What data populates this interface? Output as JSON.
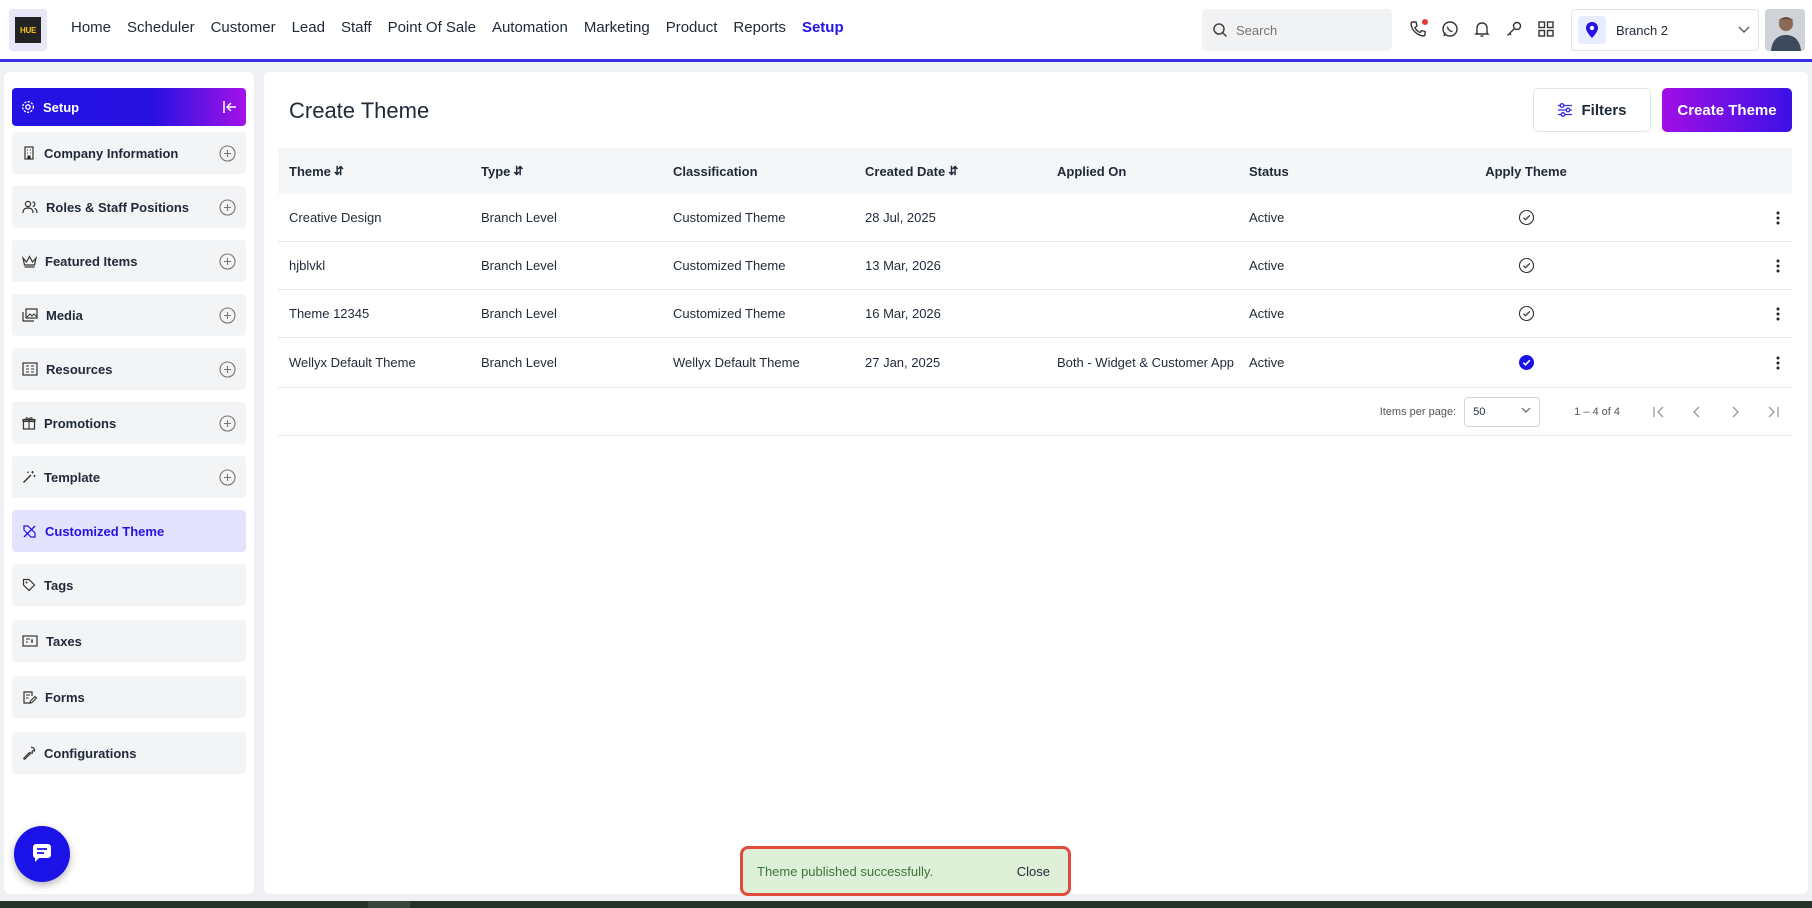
{
  "topnav": {
    "logo_text": "HUE",
    "items": [
      {
        "label": "Home"
      },
      {
        "label": "Scheduler"
      },
      {
        "label": "Customer"
      },
      {
        "label": "Lead"
      },
      {
        "label": "Staff"
      },
      {
        "label": "Point Of Sale"
      },
      {
        "label": "Automation"
      },
      {
        "label": "Marketing"
      },
      {
        "label": "Product"
      },
      {
        "label": "Reports"
      },
      {
        "label": "Setup"
      }
    ],
    "active_item": "Setup",
    "search": {
      "placeholder": "Search"
    },
    "branch": {
      "label": "Branch 2"
    },
    "accent_color": "#2412e6"
  },
  "sidebar": {
    "header": {
      "label": "Setup"
    },
    "items": [
      {
        "label": "Company Information",
        "icon": "building-icon",
        "expandable": true
      },
      {
        "label": "Roles & Staff Positions",
        "icon": "users-icon",
        "expandable": true
      },
      {
        "label": "Featured Items",
        "icon": "crown-icon",
        "expandable": true
      },
      {
        "label": "Media",
        "icon": "images-icon",
        "expandable": true
      },
      {
        "label": "Resources",
        "icon": "resources-icon",
        "expandable": true
      },
      {
        "label": "Promotions",
        "icon": "gift-icon",
        "expandable": true
      },
      {
        "label": "Template",
        "icon": "magic-wand-icon",
        "expandable": true
      },
      {
        "label": "Customized Theme",
        "icon": "ruler-pencil-icon",
        "expandable": false,
        "active": true
      },
      {
        "label": "Tags",
        "icon": "tag-icon",
        "expandable": false
      },
      {
        "label": "Taxes",
        "icon": "tax-icon",
        "expandable": false
      },
      {
        "label": "Forms",
        "icon": "form-icon",
        "expandable": false
      },
      {
        "label": "Configurations",
        "icon": "wrench-icon",
        "expandable": false
      }
    ]
  },
  "main": {
    "title": "Create Theme",
    "filters_label": "Filters",
    "create_label": "Create Theme",
    "columns": [
      "Theme",
      "Type",
      "Classification",
      "Created Date",
      "Applied On",
      "Status",
      "Apply Theme"
    ],
    "sortable_columns": [
      "Theme",
      "Type",
      "Created Date"
    ],
    "rows": [
      {
        "theme": "Creative Design",
        "type": "Branch Level",
        "classification": "Customized Theme",
        "created": "28 Jul, 2025",
        "applied_on": "",
        "status": "Active",
        "applied": false
      },
      {
        "theme": "hjblvkl",
        "type": "Branch Level",
        "classification": "Customized Theme",
        "created": "13 Mar, 2026",
        "applied_on": "",
        "status": "Active",
        "applied": false
      },
      {
        "theme": "Theme 12345",
        "type": "Branch Level",
        "classification": "Customized Theme",
        "created": "16 Mar, 2026",
        "applied_on": "",
        "status": "Active",
        "applied": false
      },
      {
        "theme": "Wellyx Default Theme",
        "type": "Branch Level",
        "classification": "Wellyx Default Theme",
        "created": "27 Jan, 2025",
        "applied_on": "Both - Widget & Customer App",
        "status": "Active",
        "applied": true
      }
    ],
    "pagination": {
      "items_per_page_label": "Items per page:",
      "items_per_page": "50",
      "range": "1 – 4 of 4"
    }
  },
  "toast": {
    "message": "Theme published successfully.",
    "close_label": "Close"
  }
}
